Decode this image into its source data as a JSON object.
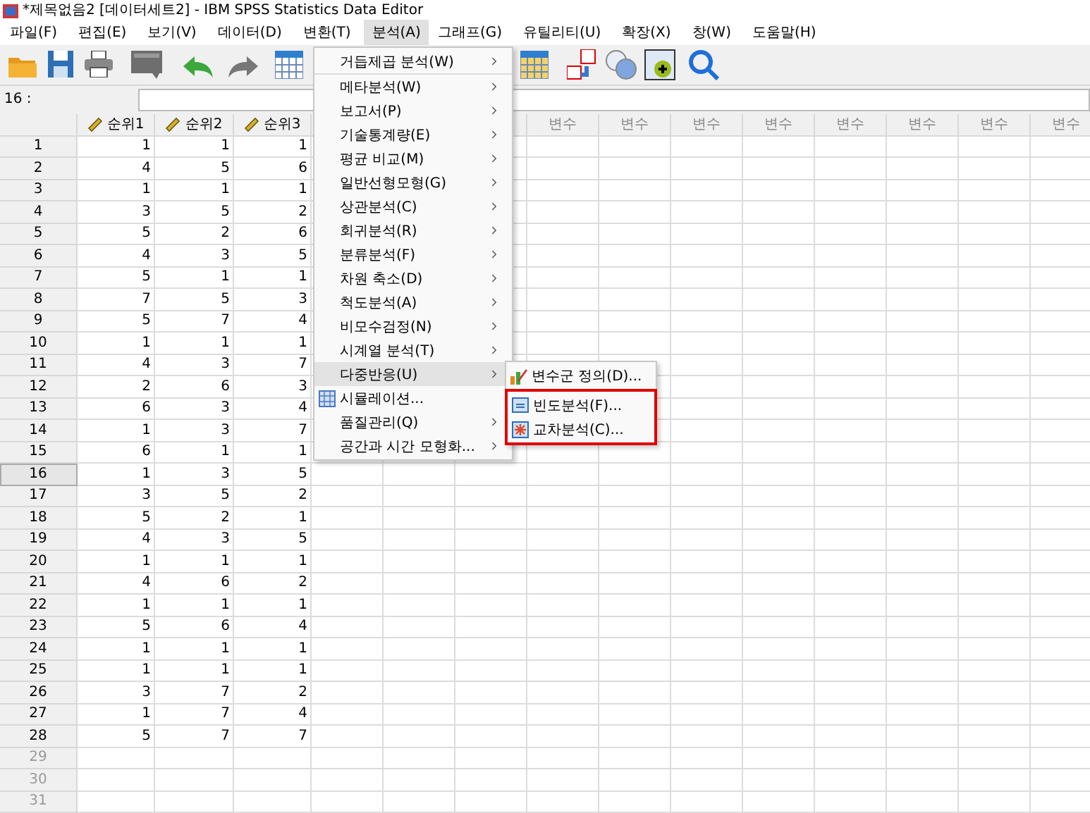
{
  "window": {
    "title": "*제목없음2 [데이터세트2] - IBM SPSS Statistics Data Editor"
  },
  "menubar": [
    {
      "label": "파일(F)",
      "selected": false
    },
    {
      "label": "편집(E)",
      "selected": false
    },
    {
      "label": "보기(V)",
      "selected": false
    },
    {
      "label": "데이터(D)",
      "selected": false
    },
    {
      "label": "변환(T)",
      "selected": false
    },
    {
      "label": "분석(A)",
      "selected": true
    },
    {
      "label": "그래프(G)",
      "selected": false
    },
    {
      "label": "유틸리티(U)",
      "selected": false
    },
    {
      "label": "확장(X)",
      "selected": false
    },
    {
      "label": "창(W)",
      "selected": false
    },
    {
      "label": "도움말(H)",
      "selected": false
    }
  ],
  "cell_editor": {
    "label": "16 :"
  },
  "columns": [
    "순위1",
    "순위2",
    "순위3"
  ],
  "empty_columns": [
    "변수",
    "변수",
    "변수",
    "변수",
    "변수",
    "변수",
    "변수",
    "변수"
  ],
  "rows": [
    {
      "label": "1",
      "values": [
        "1",
        "1",
        "1"
      ],
      "selected": false,
      "dimmed": false
    },
    {
      "label": "2",
      "values": [
        "4",
        "5",
        "6"
      ],
      "selected": false,
      "dimmed": false
    },
    {
      "label": "3",
      "values": [
        "1",
        "1",
        "1"
      ],
      "selected": false,
      "dimmed": false
    },
    {
      "label": "4",
      "values": [
        "3",
        "5",
        "2"
      ],
      "selected": false,
      "dimmed": false
    },
    {
      "label": "5",
      "values": [
        "5",
        "2",
        "6"
      ],
      "selected": false,
      "dimmed": false
    },
    {
      "label": "6",
      "values": [
        "4",
        "3",
        "5"
      ],
      "selected": false,
      "dimmed": false
    },
    {
      "label": "7",
      "values": [
        "5",
        "1",
        "1"
      ],
      "selected": false,
      "dimmed": false
    },
    {
      "label": "8",
      "values": [
        "7",
        "5",
        "3"
      ],
      "selected": false,
      "dimmed": false
    },
    {
      "label": "9",
      "values": [
        "5",
        "7",
        "4"
      ],
      "selected": false,
      "dimmed": false
    },
    {
      "label": "10",
      "values": [
        "1",
        "1",
        "1"
      ],
      "selected": false,
      "dimmed": false
    },
    {
      "label": "11",
      "values": [
        "4",
        "3",
        "7"
      ],
      "selected": false,
      "dimmed": false
    },
    {
      "label": "12",
      "values": [
        "2",
        "6",
        "3"
      ],
      "selected": false,
      "dimmed": false
    },
    {
      "label": "13",
      "values": [
        "6",
        "3",
        "4"
      ],
      "selected": false,
      "dimmed": false
    },
    {
      "label": "14",
      "values": [
        "1",
        "3",
        "7"
      ],
      "selected": false,
      "dimmed": false
    },
    {
      "label": "15",
      "values": [
        "6",
        "1",
        "1"
      ],
      "selected": false,
      "dimmed": false
    },
    {
      "label": "16",
      "values": [
        "1",
        "3",
        "5"
      ],
      "selected": true,
      "dimmed": false
    },
    {
      "label": "17",
      "values": [
        "3",
        "5",
        "2"
      ],
      "selected": false,
      "dimmed": false
    },
    {
      "label": "18",
      "values": [
        "5",
        "2",
        "1"
      ],
      "selected": false,
      "dimmed": false
    },
    {
      "label": "19",
      "values": [
        "4",
        "3",
        "5"
      ],
      "selected": false,
      "dimmed": false
    },
    {
      "label": "20",
      "values": [
        "1",
        "1",
        "1"
      ],
      "selected": false,
      "dimmed": false
    },
    {
      "label": "21",
      "values": [
        "4",
        "6",
        "2"
      ],
      "selected": false,
      "dimmed": false
    },
    {
      "label": "22",
      "values": [
        "1",
        "1",
        "1"
      ],
      "selected": false,
      "dimmed": false
    },
    {
      "label": "23",
      "values": [
        "5",
        "6",
        "4"
      ],
      "selected": false,
      "dimmed": false
    },
    {
      "label": "24",
      "values": [
        "1",
        "1",
        "1"
      ],
      "selected": false,
      "dimmed": false
    },
    {
      "label": "25",
      "values": [
        "1",
        "1",
        "1"
      ],
      "selected": false,
      "dimmed": false
    },
    {
      "label": "26",
      "values": [
        "3",
        "7",
        "2"
      ],
      "selected": false,
      "dimmed": false
    },
    {
      "label": "27",
      "values": [
        "1",
        "7",
        "4"
      ],
      "selected": false,
      "dimmed": false
    },
    {
      "label": "28",
      "values": [
        "5",
        "7",
        "7"
      ],
      "selected": false,
      "dimmed": false
    },
    {
      "label": "29",
      "selected": false,
      "dimmed": true
    },
    {
      "label": "30",
      "selected": false,
      "dimmed": true
    },
    {
      "label": "31",
      "selected": false,
      "dimmed": true
    }
  ],
  "analyze_menu": [
    {
      "label": "거듭제곱 분석(W)",
      "kind": "submenu",
      "selected": false
    },
    {
      "label": "메타분석(W)",
      "kind": "submenu",
      "selected": false
    },
    {
      "label": "보고서(P)",
      "kind": "submenu",
      "selected": false
    },
    {
      "label": "기술통계량(E)",
      "kind": "submenu",
      "selected": false
    },
    {
      "label": "평균 비교(M)",
      "kind": "submenu",
      "selected": false
    },
    {
      "label": "일반선형모형(G)",
      "kind": "submenu",
      "selected": false
    },
    {
      "label": "상관분석(C)",
      "kind": "submenu",
      "selected": false
    },
    {
      "label": "회귀분석(R)",
      "kind": "submenu",
      "selected": false
    },
    {
      "label": "분류분석(F)",
      "kind": "submenu",
      "selected": false
    },
    {
      "label": "차원 축소(D)",
      "kind": "submenu",
      "selected": false
    },
    {
      "label": "척도분석(A)",
      "kind": "submenu",
      "selected": false
    },
    {
      "label": "비모수검정(N)",
      "kind": "submenu",
      "selected": false
    },
    {
      "label": "시계열 분석(T)",
      "kind": "submenu",
      "selected": false
    },
    {
      "label": "다중반응(U)",
      "kind": "submenu",
      "selected": true
    },
    {
      "label": "시뮬레이션...",
      "kind": "command",
      "selected": false
    },
    {
      "label": "품질관리(Q)",
      "kind": "submenu",
      "selected": false
    },
    {
      "label": "공간과 시간 모형화...",
      "kind": "submenu",
      "selected": false
    }
  ],
  "multiple_response_menu": [
    {
      "label": "변수군 정의(D)...",
      "kind": "define",
      "outlined": false
    },
    {
      "label": "빈도분석(F)...",
      "kind": "frequencies",
      "outlined": true
    },
    {
      "label": "교차분석(C)...",
      "kind": "crosstabs",
      "outlined": true
    }
  ]
}
